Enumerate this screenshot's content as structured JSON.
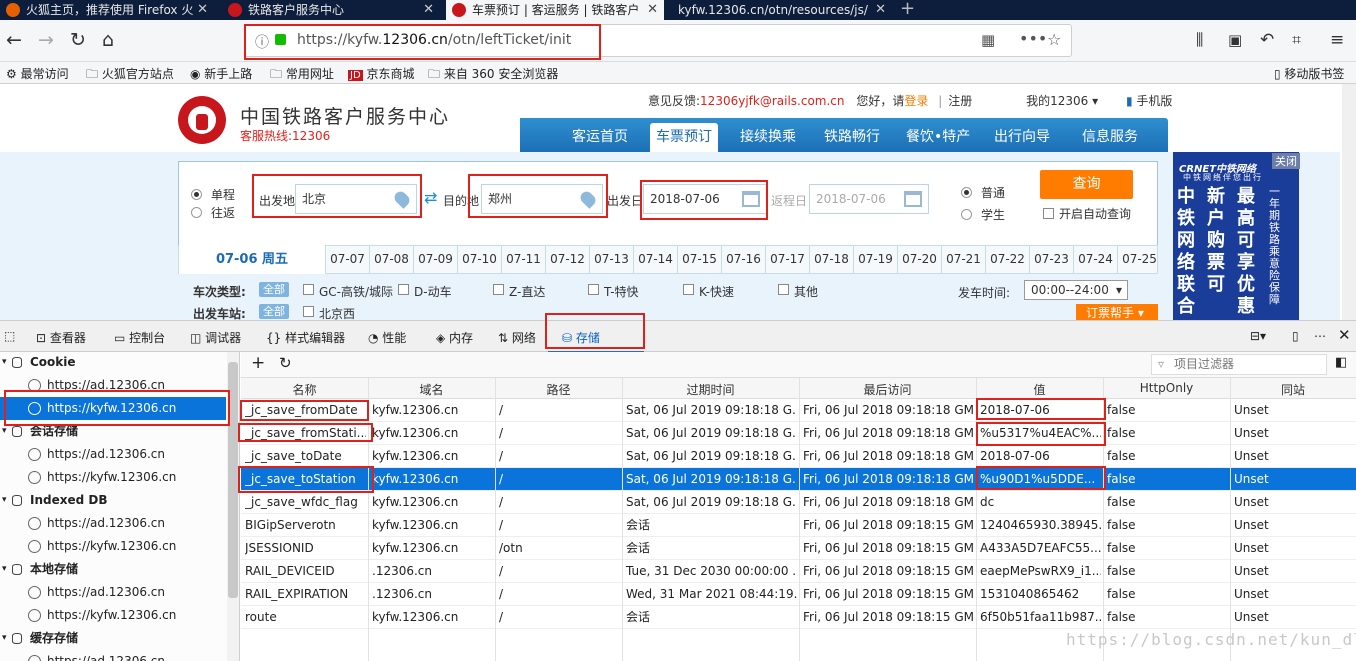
{
  "browser": {
    "tabs": [
      {
        "label": "火狐主页，推荐使用 Firefox 火",
        "active": false
      },
      {
        "label": "铁路客户服务中心",
        "active": false
      },
      {
        "label": "车票预订 | 客运服务 | 铁路客户",
        "active": true
      },
      {
        "label": "kyfw.12306.cn/otn/resources/js/",
        "active": false
      }
    ],
    "url_prefix": "https://kyfw.",
    "url_domain": "12306.cn",
    "url_path": "/otn/leftTicket/init",
    "bookmarks": [
      "最常访问",
      "火狐官方站点",
      "新手上路",
      "常用网址",
      "京东商城",
      "来自 360 安全浏览器"
    ],
    "mobile_bookmarks": "移动版书签"
  },
  "site": {
    "name": "中国铁路客户服务中心",
    "hotline": "客服热线:12306",
    "feedback_label": "意见反馈:",
    "feedback_email": "12306yjfk@rails.com.cn",
    "greeting": "您好，请",
    "login": "登录",
    "register": "注册",
    "my12306": "我的12306",
    "mobile": "手机版",
    "nav": [
      "客运首页",
      "车票预订",
      "接续换乘",
      "铁路畅行",
      "餐饮•特产",
      "出行向导",
      "信息服务"
    ],
    "form": {
      "oneway": "单程",
      "roundtrip": "往返",
      "from_label": "出发地",
      "from_value": "北京",
      "to_label": "目的地",
      "to_value": "郑州",
      "depart_label": "出发日",
      "depart_value": "2018-07-06",
      "return_label": "返程日",
      "return_value": "2018-07-06",
      "normal": "普通",
      "student": "学生",
      "query": "查询",
      "auto_query": "开启自动查询"
    },
    "date_active": "07-06 周五",
    "dates": [
      "07-07",
      "07-08",
      "07-09",
      "07-10",
      "07-11",
      "07-12",
      "07-13",
      "07-14",
      "07-15",
      "07-16",
      "07-17",
      "07-18",
      "07-19",
      "07-20",
      "07-21",
      "07-22",
      "07-23",
      "07-24",
      "07-25"
    ],
    "train_type_label": "车次类型:",
    "all": "全部",
    "train_types": [
      "GC-高铁/城际",
      "D-动车",
      "Z-直达",
      "T-特快",
      "K-快速",
      "其他"
    ],
    "depart_station_label": "出发车站:",
    "depart_station": "北京西",
    "depart_time_label": "发车时间:",
    "depart_time_value": "00:00--24:00",
    "booking_helper": "订票帮手",
    "ad_close": "关闭",
    "ad_brand": "CRNET中铁网络",
    "ad_sub": "中铁网络伴您出行",
    "ad_cols": [
      "中铁网络联合",
      "新户购票可",
      "最高可享优惠",
      "一年期铁路乘意险保障"
    ]
  },
  "devtools": {
    "tools": [
      "查看器",
      "控制台",
      "调试器",
      "样式编辑器",
      "性能",
      "内存",
      "网络",
      "存储"
    ],
    "tree": [
      {
        "type": "hdr",
        "label": "Cookie"
      },
      {
        "type": "sub",
        "label": "https://ad.12306.cn"
      },
      {
        "type": "sub",
        "label": "https://kyfw.12306.cn",
        "selected": true
      },
      {
        "type": "hdr",
        "label": "会话存储"
      },
      {
        "type": "sub",
        "label": "https://ad.12306.cn"
      },
      {
        "type": "sub",
        "label": "https://kyfw.12306.cn"
      },
      {
        "type": "hdr",
        "label": "Indexed DB"
      },
      {
        "type": "sub",
        "label": "https://ad.12306.cn"
      },
      {
        "type": "sub",
        "label": "https://kyfw.12306.cn"
      },
      {
        "type": "hdr",
        "label": "本地存储"
      },
      {
        "type": "sub",
        "label": "https://ad.12306.cn"
      },
      {
        "type": "sub",
        "label": "https://kyfw.12306.cn"
      },
      {
        "type": "hdr",
        "label": "缓存存储"
      },
      {
        "type": "sub",
        "label": "https://ad.12306.cn"
      }
    ],
    "filter_placeholder": "项目过滤器",
    "columns": [
      "名称",
      "域名",
      "路径",
      "过期时间",
      "最后访问",
      "值",
      "HttpOnly",
      "同站"
    ],
    "rows": [
      [
        "_jc_save_fromDate",
        "kyfw.12306.cn",
        "/",
        "Sat, 06 Jul 2019 09:18:18 G...",
        "Fri, 06 Jul 2018 09:18:18 GMT",
        "2018-07-06",
        "false",
        "Unset"
      ],
      [
        "_jc_save_fromStati...",
        "kyfw.12306.cn",
        "/",
        "Sat, 06 Jul 2019 09:18:18 G...",
        "Fri, 06 Jul 2018 09:18:18 GMT",
        "%u5317%u4EAC%...",
        "false",
        "Unset"
      ],
      [
        "_jc_save_toDate",
        "kyfw.12306.cn",
        "/",
        "Sat, 06 Jul 2019 09:18:18 G...",
        "Fri, 06 Jul 2018 09:18:18 GMT",
        "2018-07-06",
        "false",
        "Unset"
      ],
      [
        "_jc_save_toStation",
        "kyfw.12306.cn",
        "/",
        "Sat, 06 Jul 2019 09:18:18 G...",
        "Fri, 06 Jul 2018 09:18:18 GMT",
        "%u90D1%u5DDE...",
        "false",
        "Unset"
      ],
      [
        "_jc_save_wfdc_flag",
        "kyfw.12306.cn",
        "/",
        "Sat, 06 Jul 2019 09:18:18 G...",
        "Fri, 06 Jul 2018 09:18:18 GMT",
        "dc",
        "false",
        "Unset"
      ],
      [
        "BIGipServerotn",
        "kyfw.12306.cn",
        "/",
        "会话",
        "Fri, 06 Jul 2018 09:18:15 GMT",
        "1240465930.38945...",
        "false",
        "Unset"
      ],
      [
        "JSESSIONID",
        "kyfw.12306.cn",
        "/otn",
        "会话",
        "Fri, 06 Jul 2018 09:18:15 GMT",
        "A433A5D7EAFC55...",
        "false",
        "Unset"
      ],
      [
        "RAIL_DEVICEID",
        ".12306.cn",
        "/",
        "Tue, 31 Dec 2030 00:00:00 ...",
        "Fri, 06 Jul 2018 09:18:15 GMT",
        "eaepMePswRX9_i1...",
        "false",
        "Unset"
      ],
      [
        "RAIL_EXPIRATION",
        ".12306.cn",
        "/",
        "Wed, 31 Mar 2021 08:44:19...",
        "Fri, 06 Jul 2018 09:18:15 GMT",
        "1531040865462",
        "false",
        "Unset"
      ],
      [
        "route",
        "kyfw.12306.cn",
        "/",
        "会话",
        "Fri, 06 Jul 2018 09:18:15 GMT",
        "6f50b51faa11b987...",
        "false",
        "Unset"
      ]
    ],
    "selected_row": 3
  },
  "watermark": "https://blog.csdn.net/kun_dl",
  "colors": {
    "accent": "#0a74da",
    "annotation": "#e0211b",
    "brand_red": "#c8161d",
    "query_orange": "#ff7c00"
  }
}
